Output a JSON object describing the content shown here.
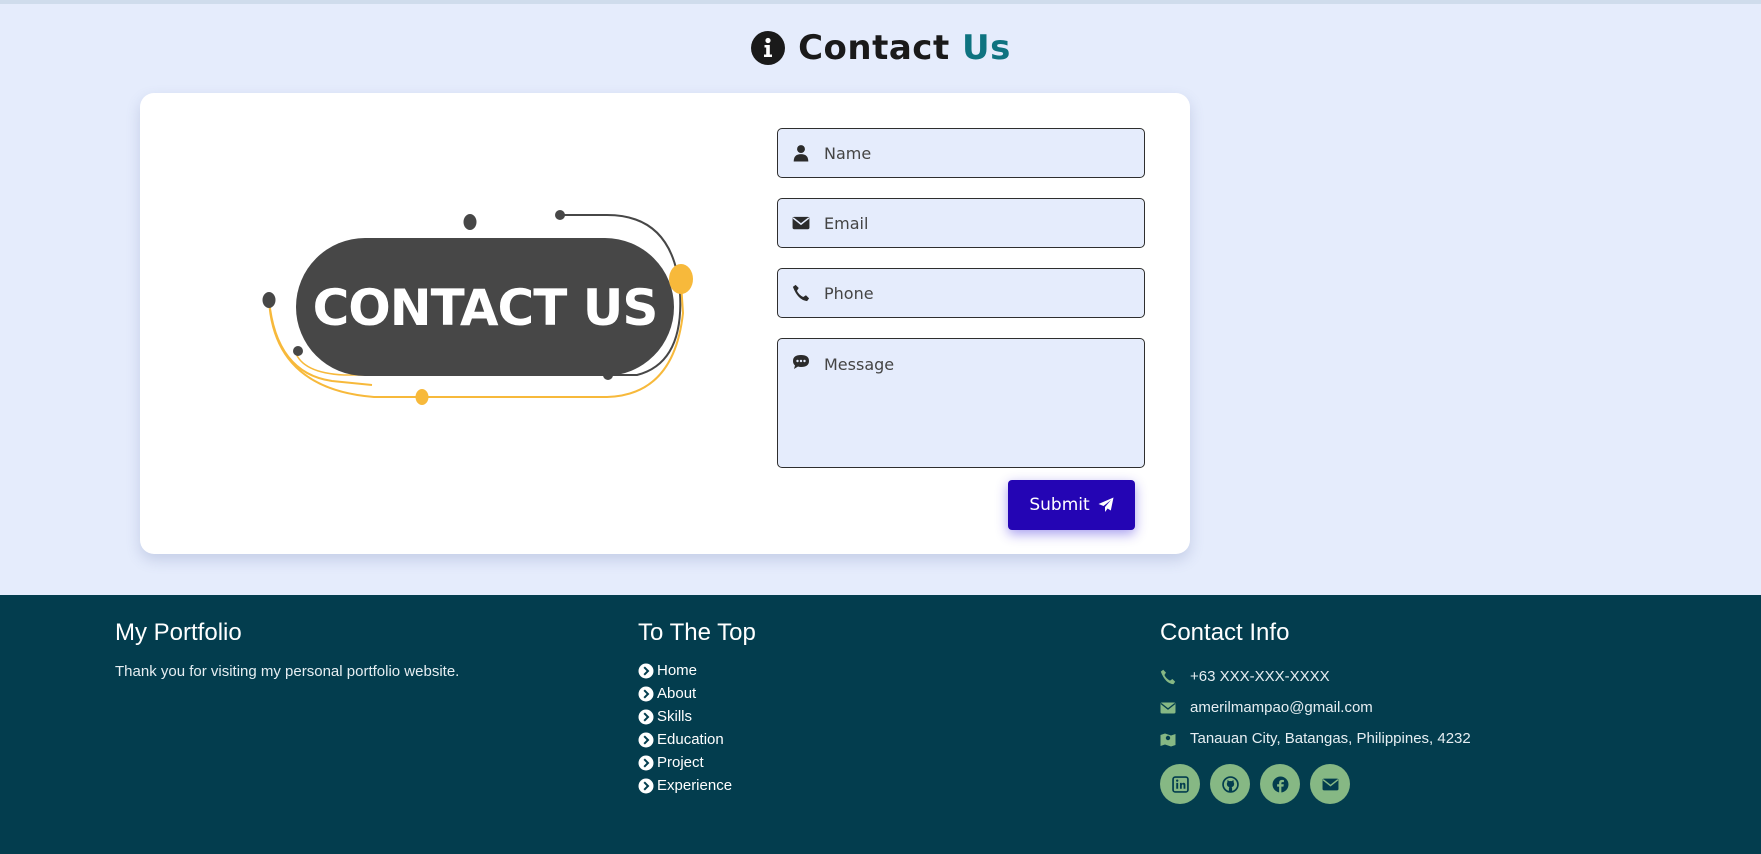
{
  "heading": {
    "title_main": "Contact",
    "title_accent": "Us"
  },
  "illustration": {
    "text": "CONTACT US"
  },
  "form": {
    "name_placeholder": "Name",
    "email_placeholder": "Email",
    "phone_placeholder": "Phone",
    "message_placeholder": "Message",
    "submit_label": "Submit"
  },
  "footer": {
    "portfolio": {
      "title": "My Portfolio",
      "text": "Thank you for visiting my personal portfolio website."
    },
    "top": {
      "title": "To The Top",
      "links": [
        "Home",
        "About",
        "Skills",
        "Education",
        "Project",
        "Experience"
      ]
    },
    "contact": {
      "title": "Contact Info",
      "phone": "+63 XXX-XXX-XXXX",
      "email": "amerilmampao@gmail.com",
      "address": "Tanauan City, Batangas, Philippines, 4232"
    },
    "socials": [
      "linkedin-icon",
      "github-icon",
      "facebook-icon",
      "envelope-icon"
    ]
  },
  "colors": {
    "page_bg": "#e5ecfc",
    "accent": "#0e7380",
    "submit": "#2405b4",
    "footer_bg": "#033d4e",
    "social_bg": "#86b884",
    "illustration_pill": "#474747",
    "illustration_gold": "#f7b93b"
  }
}
